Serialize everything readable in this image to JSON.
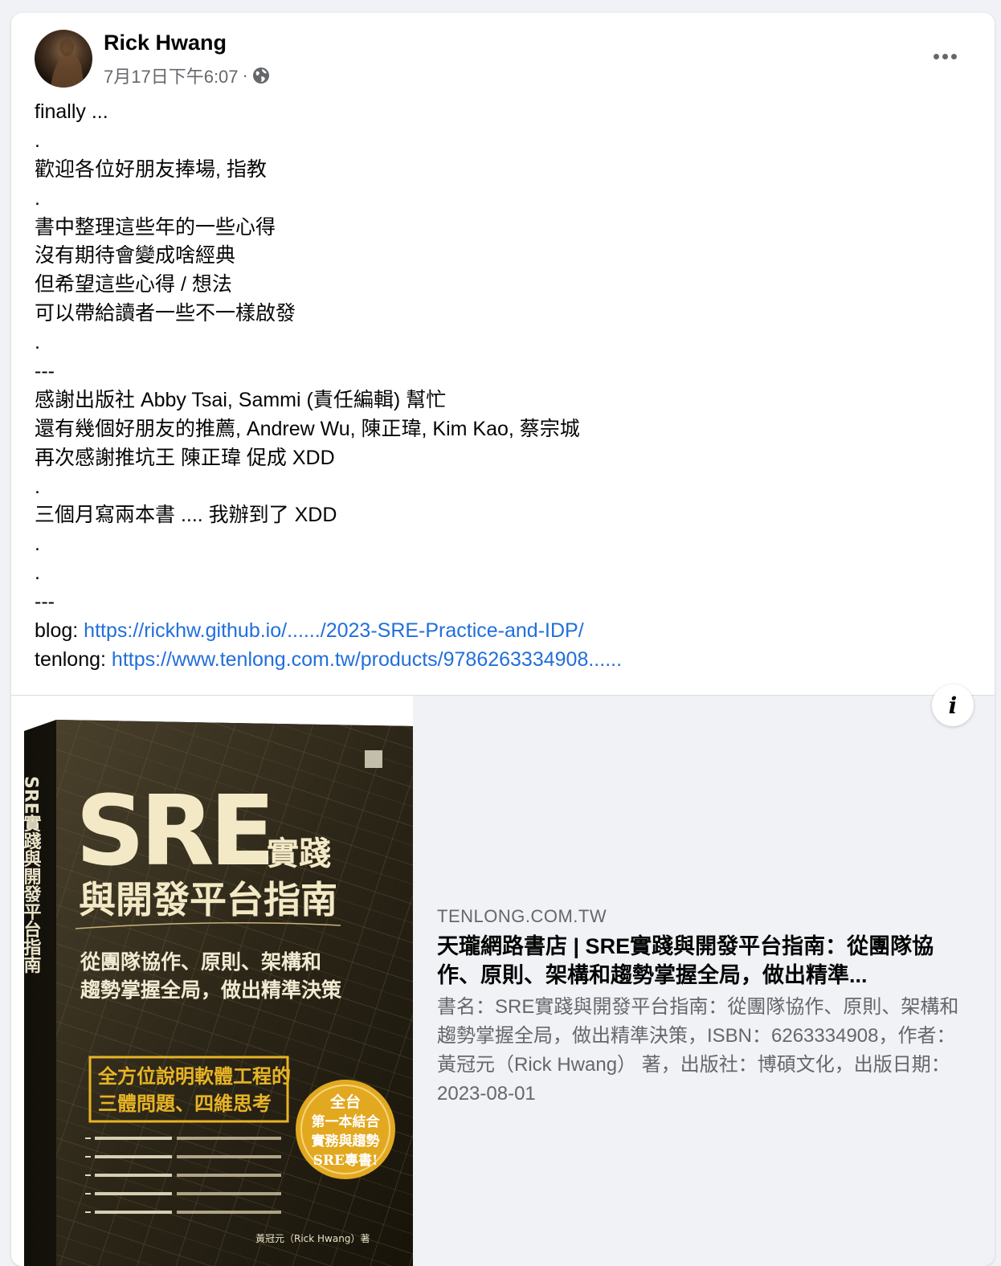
{
  "post": {
    "author": "Rick Hwang",
    "timestamp": "7月17日下午6:07",
    "separator": "·",
    "privacy_icon": "globe-icon",
    "more_icon": "more-options-icon",
    "lines": [
      "finally ...",
      ".",
      "歡迎各位好朋友捧場, 指教",
      ".",
      "書中整理這些年的一些心得",
      "沒有期待會變成啥經典",
      "但希望這些心得 / 想法",
      "可以帶給讀者一些不一樣啟發",
      ".",
      "---",
      "感謝出版社 Abby Tsai, Sammi (責任編輯) 幫忙",
      "還有幾個好朋友的推薦, Andrew Wu, 陳正瑋, Kim Kao, 蔡宗城",
      "再次感謝推坑王 陳正瑋 促成 XDD",
      ".",
      "三個月寫兩本書 .... 我辦到了 XDD",
      ".",
      ".",
      "---"
    ],
    "blog_label": "blog: ",
    "blog_link": "https://rickhw.github.io/....../2023-SRE-Practice-and-IDP/",
    "tenlong_label": "tenlong: ",
    "tenlong_link": "https://www.tenlong.com.tw/products/9786263334908......"
  },
  "preview": {
    "domain": "TENLONG.COM.TW",
    "title": "天瓏網路書店 | SRE實踐與開發平台指南：從團隊協作、原則、架構和趨勢掌握全局，做出精準...",
    "description": "書名：SRE實踐與開發平台指南：從團隊協作、原則、架構和趨勢掌握全局，做出精準決策，ISBN：6263334908，作者：黃冠元（Rick Hwang） 著，出版社：博碩文化，出版日期：2023-08-01",
    "info_icon": "info-icon",
    "cover": {
      "big_title": "SRE",
      "title_suffix": "實踐",
      "title_line2": "與開發平台指南",
      "subtitle_line1": "從團隊協作、原則、架構和",
      "subtitle_line2": "趨勢掌握全局，做出精準決策",
      "spine_text": "SRE實踐與開發平台指南",
      "banner_line1": "全方位說明軟體工程的",
      "banner_line2": "三體問題、四維思考",
      "badge_line1": "全台",
      "badge_line2": "第一本結合",
      "badge_line3": "實務與趨勢",
      "badge_line4": "SRE專書!",
      "author_line": "黃冠元（Rick Hwang）著",
      "colors": {
        "background": "#2a2416",
        "title": "#f3e9c6",
        "banner": "#e8b425",
        "badge": "#e2a820"
      }
    }
  }
}
